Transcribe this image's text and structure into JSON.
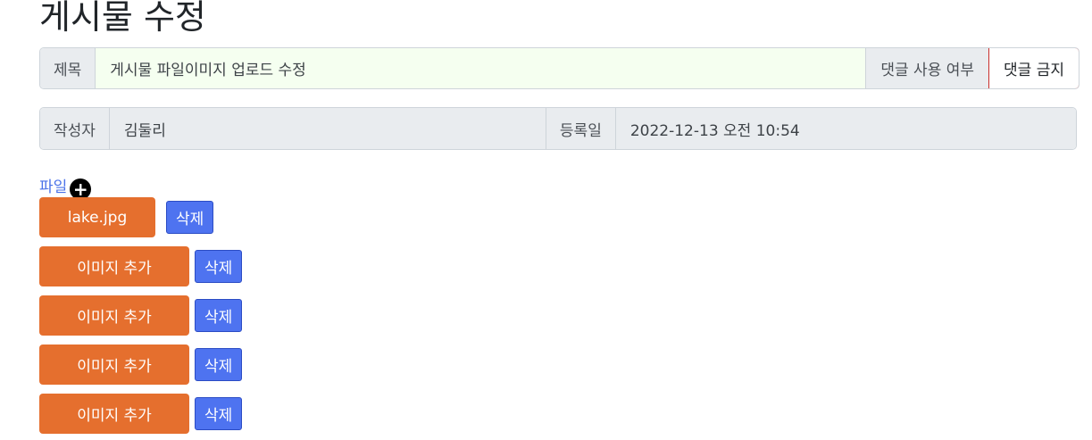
{
  "page": {
    "title": "게시물 수정"
  },
  "form": {
    "title_label": "제목",
    "title_value": "게시물 파일이미지 업로드 수정",
    "comment_label": "댓글 사용 여부",
    "comment_value": "댓글 금지",
    "author_label": "작성자",
    "author_value": "김둘리",
    "date_label": "등록일",
    "date_value": "2022-12-13 오전 10:54"
  },
  "files": {
    "label": "파일",
    "add_icon": "plus-circle-icon",
    "items": [
      {
        "name": "lake.jpg",
        "delete": "삭제"
      },
      {
        "name": "이미지 추가",
        "delete": "삭제"
      },
      {
        "name": "이미지 추가",
        "delete": "삭제"
      },
      {
        "name": "이미지 추가",
        "delete": "삭제"
      },
      {
        "name": "이미지 추가",
        "delete": "삭제"
      }
    ]
  },
  "colors": {
    "file_button": "#e56f2e",
    "delete_button": "#4e73f0",
    "comment_border": "#c9302c"
  }
}
